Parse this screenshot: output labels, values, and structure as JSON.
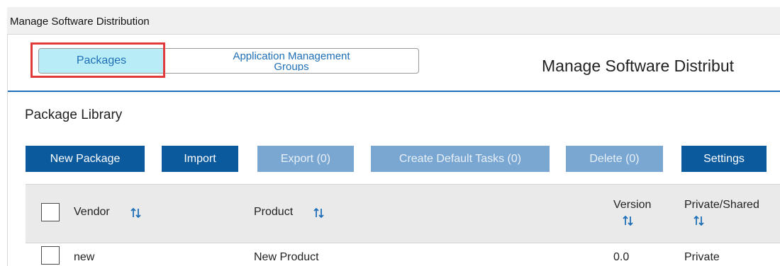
{
  "window": {
    "title": "Manage Software Distribution"
  },
  "tabs": [
    {
      "label": "Packages",
      "selected": true
    },
    {
      "label_line1": "Application Management",
      "label_line2": "Groups",
      "selected": false
    }
  ],
  "page_heading": "Manage Software Distribut",
  "section_title": "Package Library",
  "toolbar": {
    "new_package": "New Package",
    "import": "Import",
    "export": "Export (0)",
    "create_default_tasks": "Create Default Tasks (0)",
    "delete": "Delete (0)",
    "settings": "Settings"
  },
  "table": {
    "columns": {
      "vendor": "Vendor",
      "product": "Product",
      "version": "Version",
      "private_shared": "Private/Shared"
    },
    "rows": [
      {
        "vendor": "new",
        "product": "New Product",
        "version": "0.0",
        "private_shared": "Private"
      }
    ]
  },
  "colors": {
    "accent": "#1e6fb8",
    "button_primary": "#0b5a9e",
    "button_disabled": "#7aa7d2",
    "tab_selected": "#b8ecf6",
    "highlight": "#e03a3a"
  },
  "icons": {
    "sort": "sort-arrows-icon"
  }
}
